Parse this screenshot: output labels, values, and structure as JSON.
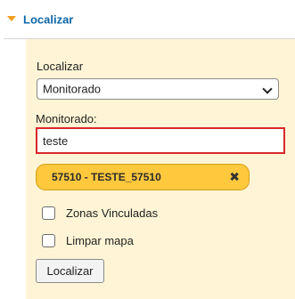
{
  "section": {
    "title": "Localizar",
    "expanded": true,
    "arrow_icon": "triangle-down-icon",
    "accent_color": "#f0a01e",
    "title_color": "#0f67a8"
  },
  "form": {
    "type_label": "Localizar",
    "type_select": {
      "value": "Monitorado",
      "options": [
        "Monitorado"
      ],
      "chevron_icon": "chevron-down-icon"
    },
    "monitored_label": "Monitorado:",
    "monitored_input": {
      "value": "teste",
      "border_color": "#d9262b"
    },
    "selected_tag": {
      "label": "57510 - TESTE_57510",
      "remove_icon": "close-x-icon",
      "color": "#ffc83d"
    },
    "checkboxes": [
      {
        "label": "Zonas Vinculadas",
        "checked": false
      },
      {
        "label": "Limpar mapa",
        "checked": false
      }
    ],
    "submit_label": "Localizar"
  },
  "colors": {
    "panel_background": "#fff5d6",
    "divider": "#d6d6d6"
  }
}
